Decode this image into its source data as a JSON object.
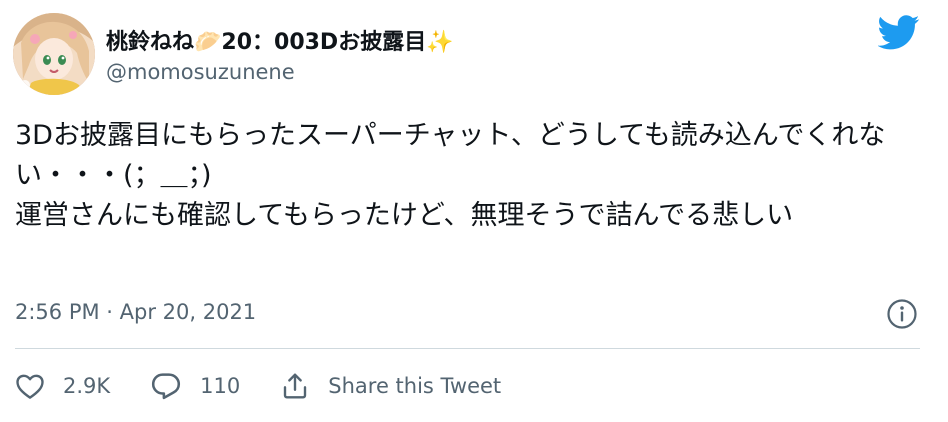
{
  "user": {
    "display_name": "桃鈴ねね🥟20：003Dお披露目✨",
    "handle": "@momosuzunene",
    "avatar_icon": "avatar-image"
  },
  "tweet": {
    "text": "3Dお披露目にもらったスーパーチャット、どうしても読み込んでくれない・・・(；＿；)\n運営さんにも確認してもらったけど、無理そうで詰んでる悲しい",
    "timestamp": "2:56 PM · Apr 20, 2021"
  },
  "actions": {
    "likes": "2.9K",
    "replies": "110",
    "share_label": "Share this Tweet"
  },
  "icons": {
    "brand": "twitter-bird-icon",
    "info": "info-icon",
    "like": "heart-icon",
    "reply": "comment-bubble-icon",
    "share": "share-icon"
  },
  "colors": {
    "brand_blue": "#1d9bf0",
    "text": "#0f1419",
    "secondary": "#536471",
    "divider": "#cfd9de"
  }
}
